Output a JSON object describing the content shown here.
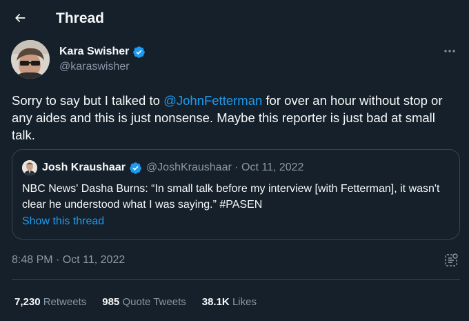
{
  "header": {
    "title": "Thread",
    "back_icon": "arrow-left-icon"
  },
  "tweet": {
    "author": {
      "name": "Kara Swisher",
      "handle": "@karaswisher",
      "verified": true
    },
    "text_before": "Sorry to say but I talked to ",
    "mention": "@JohnFetterman",
    "text_after": " for over an hour without stop or any aides and this is just nonsense. Maybe this reporter is just bad at small talk.",
    "timestamp": "8:48 PM · Oct 11, 2022"
  },
  "quote": {
    "author_name": "Josh Kraushaar",
    "meta": "@JoshKraushaar · Oct 11, 2022",
    "text": "NBC News' Dasha Burns: “In small talk before my interview [with Fetterman], it wasn't clear he understood what I was saying.” #PASEN",
    "link": "Show this thread"
  },
  "stats": {
    "retweets_count": "7,230",
    "retweets_label": "Retweets",
    "quotes_count": "985",
    "quotes_label": "Quote Tweets",
    "likes_count": "38.1K",
    "likes_label": "Likes"
  },
  "colors": {
    "background": "#15202b",
    "accent": "#1d9bf0",
    "secondary_text": "#8b98a5",
    "border": "#38444d"
  }
}
